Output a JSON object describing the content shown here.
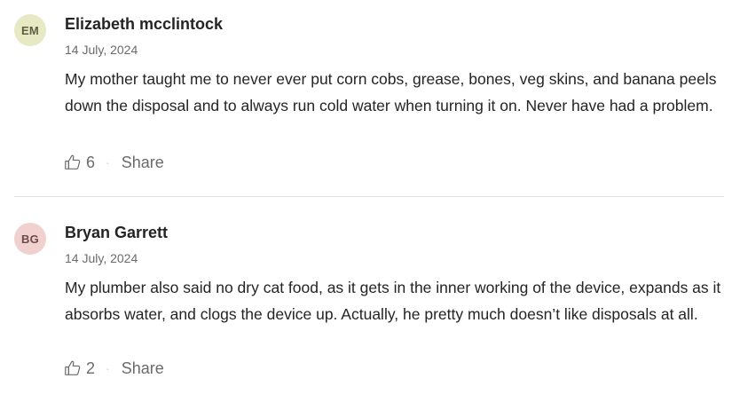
{
  "comments": [
    {
      "initials": "EM",
      "avatar_bg": "#e6e9c4",
      "avatar_fg": "#5b5f3e",
      "author": "Elizabeth mcclintock",
      "date": "14 July, 2024",
      "text": "My mother taught me to never ever put corn cobs, grease, bones, veg skins, and banana peels down the disposal and to always run cold water when turning it on. Never have had a problem.",
      "claps": "6",
      "share_label": "Share"
    },
    {
      "initials": "BG",
      "avatar_bg": "#f1d0d0",
      "avatar_fg": "#6e4a4a",
      "author": "Bryan Garrett",
      "date": "14 July, 2024",
      "text": "My plumber also said no dry cat food, as it gets in the inner working of the device, expands as it absorbs water, and clogs the device up. Actually, he pretty much doesn’t like disposals at all.",
      "claps": "2",
      "share_label": "Share"
    }
  ],
  "separator": "·",
  "icons": {
    "clap": "clap-icon"
  },
  "colors": {
    "text": "#242424",
    "muted": "#6b6b6b",
    "divider": "#e6e6e6"
  }
}
